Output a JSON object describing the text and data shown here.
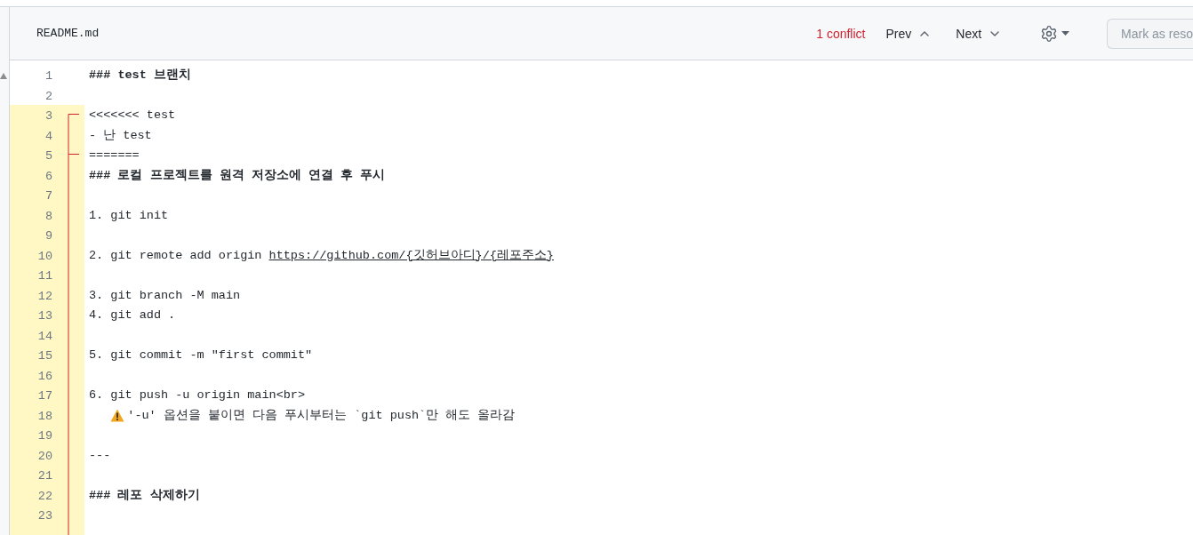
{
  "header": {
    "filename": "README.md",
    "conflict_count": "1 conflict",
    "prev": "Prev",
    "next": "Next",
    "mark_resolved": {
      "label": "Mark as reso",
      "disabled": true
    }
  },
  "editor": {
    "lines": [
      {
        "number": "1",
        "text": "### test 브랜치",
        "kind": "heading",
        "conflict": false
      },
      {
        "number": "2",
        "kind": "plain",
        "conflict": false
      },
      {
        "number": "3",
        "text": "<<<<<<< test",
        "kind": "conflict_start",
        "conflict": true
      },
      {
        "number": "4",
        "text": "- 난 test",
        "kind": "plain",
        "conflict": true
      },
      {
        "number": "5",
        "text": "=======",
        "kind": "conflict_divider",
        "conflict": true
      },
      {
        "number": "6",
        "text": "### 로컬 프로젝트를 원격 저장소에 연결 후 푸시",
        "kind": "heading",
        "conflict": true
      },
      {
        "number": "7",
        "kind": "plain",
        "conflict": true
      },
      {
        "number": "8",
        "text": "1. git init",
        "kind": "plain",
        "conflict": true
      },
      {
        "number": "9",
        "kind": "plain",
        "conflict": true
      },
      {
        "number": "10",
        "text": "2. git remote add origin",
        "link": "https://github.com/{깃허브아디}/{레포주소}",
        "kind": "link",
        "conflict": true
      },
      {
        "number": "11",
        "kind": "plain",
        "conflict": true
      },
      {
        "number": "12",
        "text": "3. git branch -M main",
        "kind": "plain",
        "conflict": true
      },
      {
        "number": "13",
        "text": "4. git add .",
        "kind": "plain",
        "conflict": true
      },
      {
        "number": "14",
        "kind": "plain",
        "conflict": true
      },
      {
        "number": "15",
        "text": "5. git commit -m \"first commit\"",
        "kind": "plain",
        "conflict": true
      },
      {
        "number": "16",
        "kind": "plain",
        "conflict": true
      },
      {
        "number": "17",
        "text": "6. git push -u origin main<br>",
        "kind": "plain",
        "conflict": true
      },
      {
        "number": "18",
        "text": "'-u' 옵션을 붙이면 다음 푸시부터는 `git push`만 해도 올라감",
        "kind": "note",
        "conflict": true
      },
      {
        "number": "19",
        "kind": "plain",
        "conflict": true
      },
      {
        "number": "20",
        "text": "---",
        "kind": "plain",
        "conflict": true
      },
      {
        "number": "21",
        "kind": "plain",
        "conflict": true
      },
      {
        "number": "22",
        "text": "### 레포 삭제하기",
        "kind": "heading",
        "conflict": true
      },
      {
        "number": "23",
        "kind": "plain",
        "conflict": true
      },
      {
        "kind": "plain",
        "conflict": true
      }
    ]
  }
}
